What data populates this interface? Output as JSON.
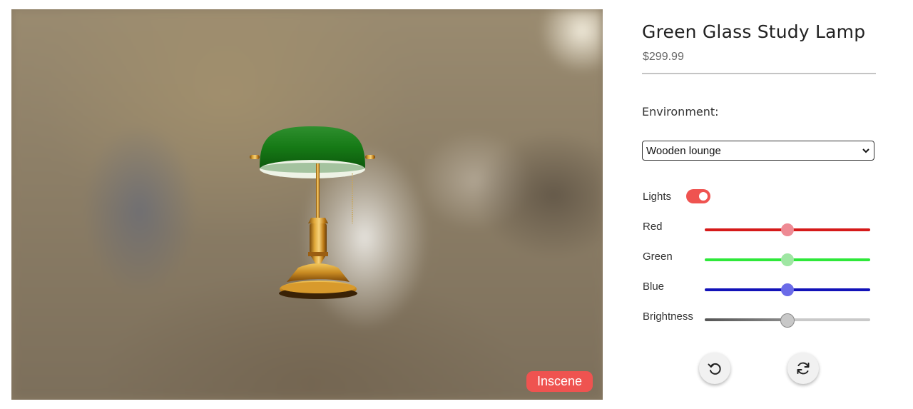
{
  "product": {
    "title": "Green Glass Study Lamp",
    "price": "$299.99"
  },
  "viewer": {
    "badge_label": "Inscene",
    "badge_color": "#ef5350",
    "model_icon": "bankers-lamp-model"
  },
  "environment": {
    "label": "Environment:",
    "selected": "Wooden lounge"
  },
  "lights": {
    "label": "Lights",
    "on": true,
    "toggle_color": "#ef5350"
  },
  "sliders": [
    {
      "label": "Red",
      "value": 0.5,
      "track_color": "#d51a1a",
      "thumb_color": "#ee8a94"
    },
    {
      "label": "Green",
      "value": 0.5,
      "track_color": "#2ee83a",
      "thumb_color": "#9fe6a3"
    },
    {
      "label": "Blue",
      "value": 0.5,
      "track_color": "#1212b8",
      "thumb_color": "#6b6be8"
    },
    {
      "label": "Brightness",
      "value": 0.5,
      "track_color": "#c9c9c9",
      "thumb_color": "#c8c8c8"
    }
  ],
  "actions": [
    {
      "name": "reset-rotation-button",
      "icon": "rotate-ccw-icon"
    },
    {
      "name": "auto-rotate-button",
      "icon": "refresh-icon"
    }
  ]
}
